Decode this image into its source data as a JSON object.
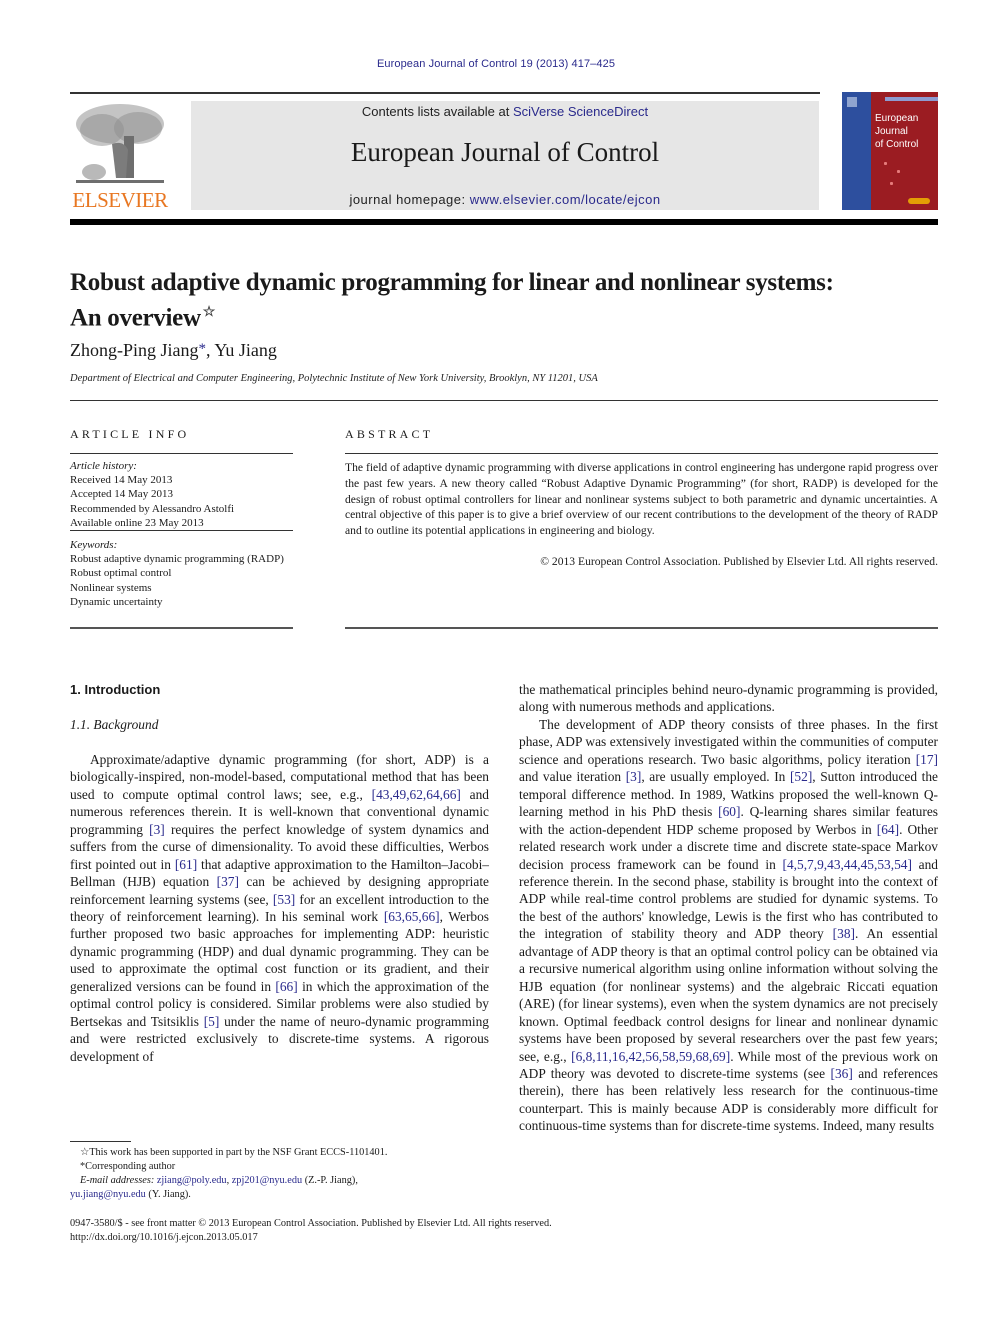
{
  "running_head": "European Journal of Control 19 (2013) 417–425",
  "masthead": {
    "publisher_logo_text": "ELSEVIER",
    "contents_prefix": "Contents lists available at ",
    "contents_link": "SciVerse ScienceDirect",
    "journal_name": "European Journal of Control",
    "homepage_prefix": "journal homepage: ",
    "homepage_link": "www.elsevier.com/locate/ejcon",
    "cover_title_lines": [
      "European",
      "Journal",
      "of Control"
    ],
    "colors": {
      "elsevier_orange": "#e87722",
      "link_blue": "#2a2a8c",
      "masthead_gray": "#e6e6e6",
      "cover_red": "#9b1c22",
      "cover_blue": "#2d4f9e"
    }
  },
  "article": {
    "title_line1": "Robust adaptive dynamic programming for linear and nonlinear systems:",
    "title_line2": "An overview",
    "title_note_mark": "☆",
    "author1": "Zhong-Ping Jiang",
    "author1_mark": "*",
    "author_separator": ", ",
    "author2": "Yu Jiang",
    "affiliation": "Department of Electrical and Computer Engineering, Polytechnic Institute of New York University, Brooklyn, NY 11201, USA"
  },
  "article_info": {
    "heading": "ARTICLE INFO",
    "history_label": "Article history:",
    "history": [
      "Received 14 May 2013",
      "Accepted 14 May 2013",
      "Recommended by Alessandro Astolfi",
      "Available online 23 May 2013"
    ],
    "keywords_label": "Keywords:",
    "keywords": [
      "Robust adaptive dynamic programming (RADP)",
      "Robust optimal control",
      "Nonlinear systems",
      "Dynamic uncertainty"
    ]
  },
  "abstract": {
    "heading": "ABSTRACT",
    "text": "The field of adaptive dynamic programming with diverse applications in control engineering has undergone rapid progress over the past few years. A new theory called “Robust Adaptive Dynamic Programming” (for short, RADP) is developed for the design of robust optimal controllers for linear and nonlinear systems subject to both parametric and dynamic uncertainties. A central objective of this paper is to give a brief overview of our recent contributions to the development of the theory of RADP and to outline its potential applications in engineering and biology.",
    "copyright": "© 2013 European Control Association. Published by Elsevier Ltd. All rights reserved."
  },
  "body": {
    "section1_heading": "1.  Introduction",
    "subsection_heading": "1.1.  Background",
    "left_paragraph": [
      {
        "t": "Approximate/adaptive dynamic programming (for short, ADP) is a biologically-inspired, non-model-based, computational method that has been used to compute optimal control laws; see, e.g., "
      },
      {
        "c": "[43,49,62,64,66]"
      },
      {
        "t": " and numerous references therein. It is well-known that conventional dynamic programming "
      },
      {
        "c": "[3]"
      },
      {
        "t": " requires the perfect knowledge of system dynamics and suffers from the curse of dimensionality. To avoid these difficulties, Werbos first pointed out in "
      },
      {
        "c": "[61]"
      },
      {
        "t": " that adaptive approximation to the Hamilton–Jacobi–Bellman (HJB) equation "
      },
      {
        "c": "[37]"
      },
      {
        "t": " can be achieved by designing appropriate reinforcement learning systems (see, "
      },
      {
        "c": "[53]"
      },
      {
        "t": " for an excellent introduction to the theory of reinforcement learning). In his seminal work "
      },
      {
        "c": "[63,65,66]"
      },
      {
        "t": ", Werbos further proposed two basic approaches for implementing ADP: heuristic dynamic programming (HDP) and dual dynamic programming. They can be used to approximate the optimal cost function or its gradient, and their generalized versions can be found in "
      },
      {
        "c": "[66]"
      },
      {
        "t": " in which the approximation of the optimal control policy is considered. Similar problems were also studied by Bertsekas and Tsitsiklis "
      },
      {
        "c": "[5]"
      },
      {
        "t": " under the name of neuro-dynamic programming and were restricted exclusively to discrete-time systems. A rigorous development of"
      }
    ],
    "right_continuation": "the mathematical principles behind neuro-dynamic programming is provided, along with numerous methods and applications.",
    "right_paragraph": [
      {
        "t": "The development of ADP theory consists of three phases. In the first phase, ADP was extensively investigated within the communities of computer science and operations research. Two basic algorithms, policy iteration "
      },
      {
        "c": "[17]"
      },
      {
        "t": " and value iteration "
      },
      {
        "c": "[3]"
      },
      {
        "t": ", are usually employed. In "
      },
      {
        "c": "[52]"
      },
      {
        "t": ", Sutton introduced the temporal difference method. In 1989, Watkins proposed the well-known Q-learning method in his PhD thesis "
      },
      {
        "c": "[60]"
      },
      {
        "t": ". Q-learning shares similar features with the action-dependent HDP scheme proposed by Werbos in "
      },
      {
        "c": "[64]"
      },
      {
        "t": ". Other related research work under a discrete time and discrete state-space Markov decision process framework can be found in "
      },
      {
        "c": "[4,5,7,9,43,44,45,53,54]"
      },
      {
        "t": " and reference therein. In the second phase, stability is brought into the context of ADP while real-time control problems are studied for dynamic systems. To the best of the authors' knowledge, Lewis is the first who has contributed to the integration of stability theory and ADP theory "
      },
      {
        "c": "[38]"
      },
      {
        "t": ". An essential advantage of ADP theory is that an optimal control policy can be obtained via a recursive numerical algorithm using online information without solving the HJB equation (for nonlinear systems) and the algebraic Riccati equation (ARE) (for linear systems), even when the system dynamics are not precisely known. Optimal feedback control designs for linear and nonlinear dynamic systems have been proposed by several researchers over the past few years; see, e.g., "
      },
      {
        "c": "[6,8,11,16,42,56,58,59,68,69]"
      },
      {
        "t": ". While most of the previous work on ADP theory was devoted to discrete-time systems (see "
      },
      {
        "c": "[36]"
      },
      {
        "t": " and references therein), there has been relatively less research for the continuous-time counterpart. This is mainly because ADP is considerably more difficult for continuous-time systems than for discrete-time systems. Indeed, many results"
      }
    ]
  },
  "footnotes": {
    "funding_mark": "☆",
    "funding": "This work has been supported in part by the NSF Grant ECCS-1101401.",
    "corresponding_mark": "*",
    "corresponding": "Corresponding author",
    "email_label": "E-mail addresses: ",
    "email1": "zjiang@poly.edu",
    "email_sep": ", ",
    "email2": "zpj201@nyu.edu",
    "email2_owner": " (Z.-P. Jiang),",
    "email3": "yu.jiang@nyu.edu",
    "email3_owner": " (Y. Jiang)."
  },
  "imprint": {
    "line1": "0947-3580/$ - see front matter © 2013 European Control Association. Published by Elsevier Ltd. All rights reserved.",
    "doi": "http://dx.doi.org/10.1016/j.ejcon.2013.05.017"
  }
}
